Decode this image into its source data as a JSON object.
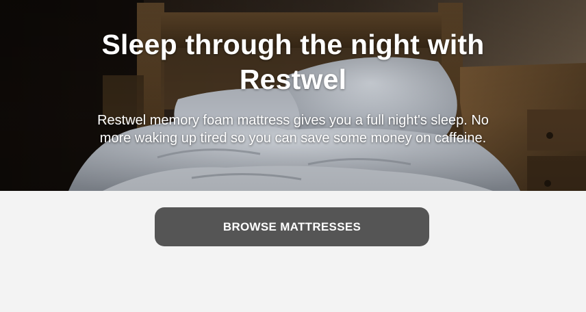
{
  "hero": {
    "headline_line1": "Sleep through the night with",
    "headline_line2": "Restwel",
    "subcopy_line1": "Restwel memory foam mattress gives you a full night's sleep. No",
    "subcopy_line2": "more waking up tired so you can save some money on caffeine."
  },
  "cta": {
    "label": "BROWSE MATTRESSES"
  },
  "colors": {
    "page_background": "#f3f3f3",
    "button_background": "#555555",
    "button_text": "#ffffff",
    "headline_text": "#ffffff"
  }
}
